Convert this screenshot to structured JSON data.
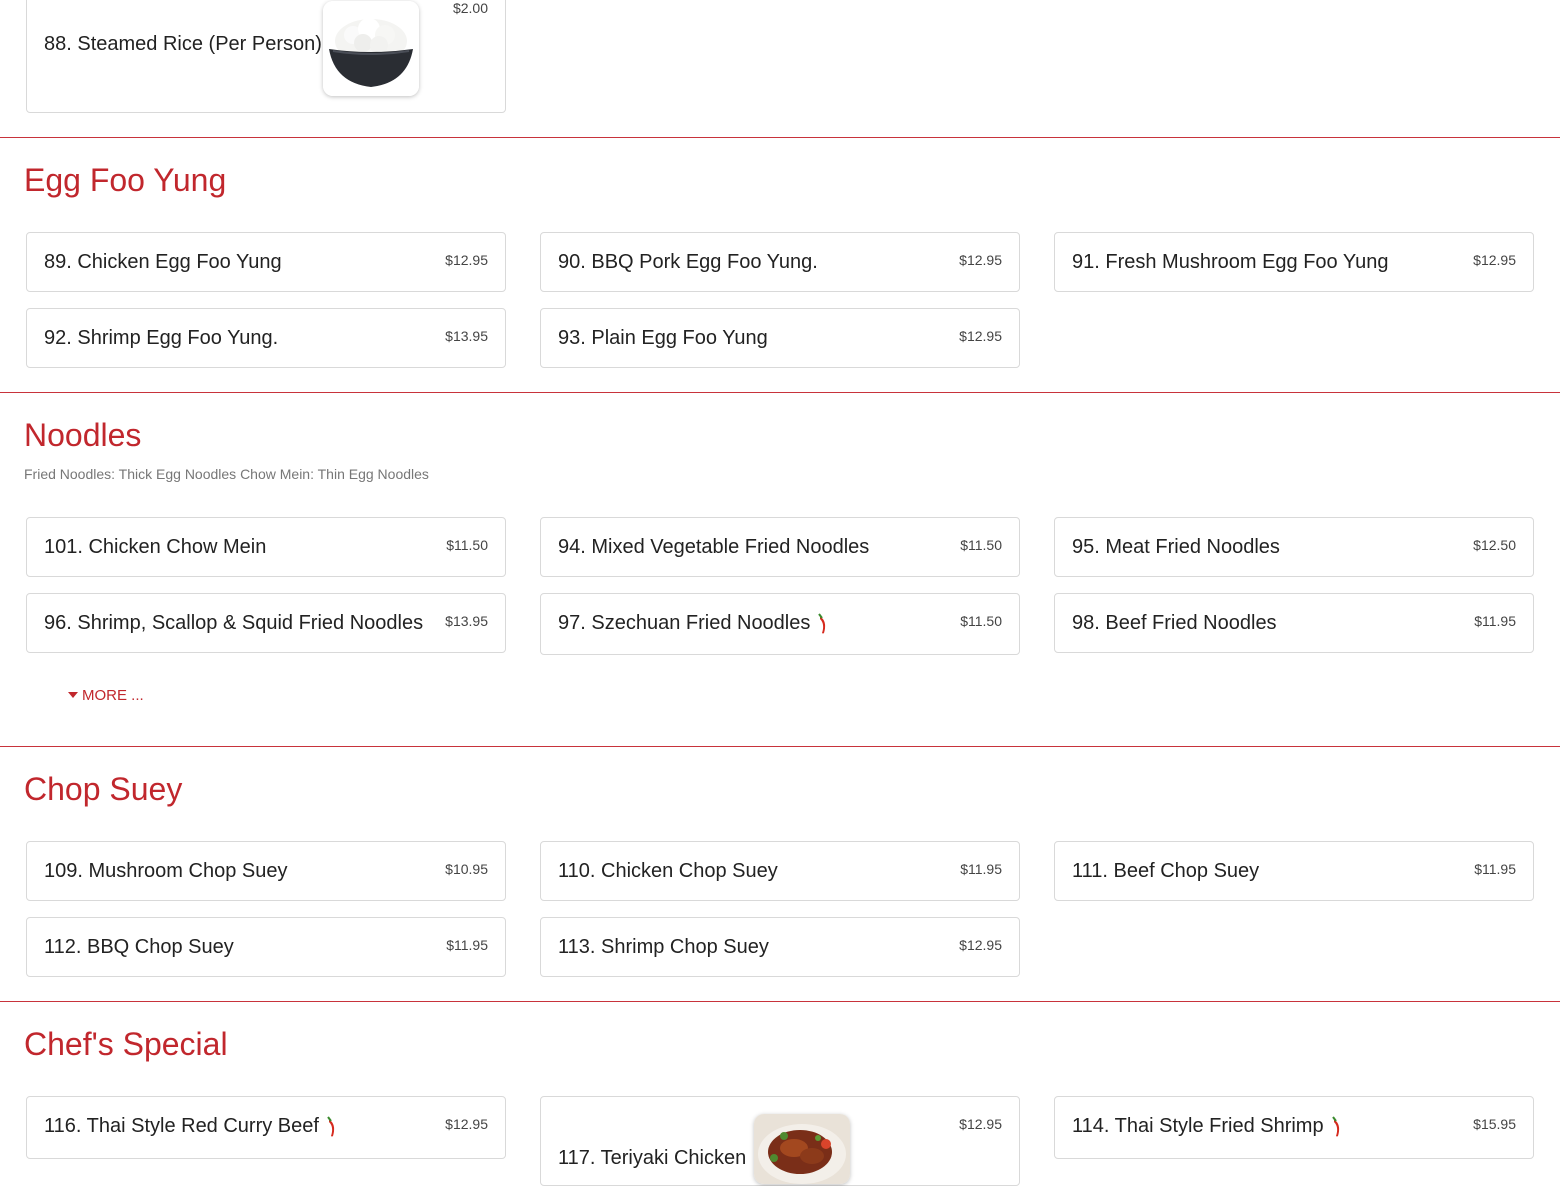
{
  "rice": {
    "name": "88. Steamed Rice (Per Person)",
    "price": "$2.00",
    "image": "steamed-rice-bowl"
  },
  "egg_foo_yung": {
    "title": "Egg Foo Yung",
    "items": [
      {
        "name": "89. Chicken Egg Foo Yung",
        "price": "$12.95"
      },
      {
        "name": "90. BBQ Pork Egg Foo Yung.",
        "price": "$12.95"
      },
      {
        "name": "91. Fresh Mushroom Egg Foo Yung",
        "price": "$12.95"
      },
      {
        "name": "92. Shrimp Egg Foo Yung.",
        "price": "$13.95"
      },
      {
        "name": "93. Plain Egg Foo Yung",
        "price": "$12.95"
      }
    ]
  },
  "noodles": {
    "title": "Noodles",
    "note": "Fried Noodles: Thick Egg Noodles Chow Mein: Thin Egg Noodles",
    "items": [
      {
        "name": "101. Chicken Chow Mein",
        "price": "$11.50"
      },
      {
        "name": "94. Mixed Vegetable Fried Noodles",
        "price": "$11.50"
      },
      {
        "name": "95. Meat Fried Noodles",
        "price": "$12.50"
      },
      {
        "name": "96. Shrimp, Scallop & Squid Fried Noodles",
        "price": "$13.95"
      },
      {
        "name": "97. Szechuan Fried Noodles",
        "price": "$11.50",
        "icon": "chili-pepper-icon"
      },
      {
        "name": "98. Beef Fried Noodles",
        "price": "$11.95"
      }
    ],
    "more_label": "MORE ..."
  },
  "chop_suey": {
    "title": "Chop Suey",
    "items": [
      {
        "name": "109. Mushroom Chop Suey",
        "price": "$10.95"
      },
      {
        "name": "110. Chicken Chop Suey",
        "price": "$11.95"
      },
      {
        "name": "111. Beef Chop Suey",
        "price": "$11.95"
      },
      {
        "name": "112. BBQ Chop Suey",
        "price": "$11.95"
      },
      {
        "name": "113. Shrimp Chop Suey",
        "price": "$12.95"
      }
    ]
  },
  "chefs_special": {
    "title": "Chef's Special",
    "items": [
      {
        "name": "116. Thai Style Red Curry Beef",
        "price": "$12.95",
        "icon": "chili-pepper-icon"
      },
      {
        "name": "117. Teriyaki Chicken",
        "price": "$12.95",
        "image": "teriyaki-chicken-photo"
      },
      {
        "name": "114. Thai Style Fried Shrimp",
        "price": "$15.95",
        "icon": "chili-pepper-icon"
      }
    ]
  },
  "colors": {
    "accent": "#c1272d",
    "divider": "#c8333b",
    "card_border": "#d9d9d9"
  }
}
